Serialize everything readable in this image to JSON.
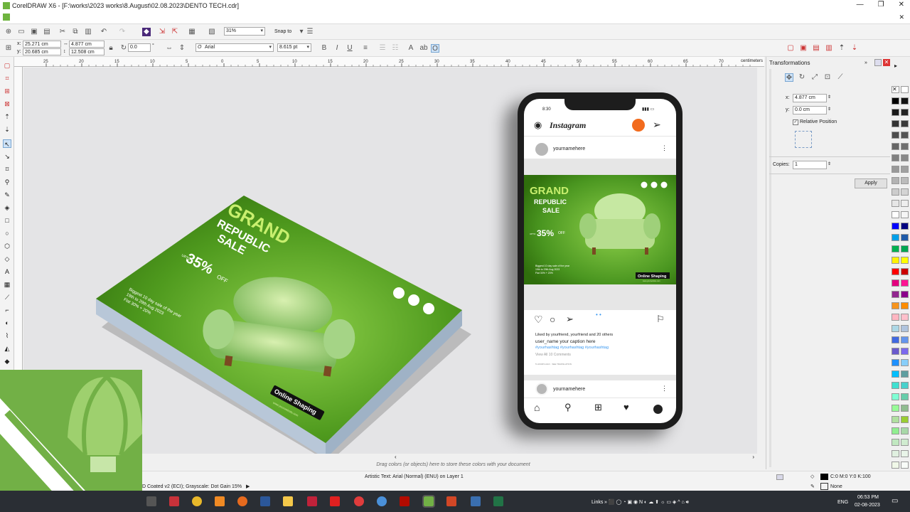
{
  "window": {
    "title": "CorelDRAW X6 - [F:\\works\\2023 works\\8.August\\02.08.2023\\DENTO TECH.cdr]"
  },
  "standard_bar": {
    "zoom": "31%",
    "snap_to": "Snap to"
  },
  "property_bar": {
    "x_pos": "25.271 cm",
    "y_pos": "20.685 cm",
    "width": "4.877 cm",
    "height": "12.508 cm",
    "rotation": "0.0",
    "degree_symbol": "°",
    "font_name": "Arial",
    "font_size": "8.615 pt"
  },
  "ruler": {
    "h_ticks": [
      "25",
      "20",
      "15",
      "10",
      "5",
      "0",
      "5",
      "10",
      "15",
      "20",
      "25",
      "30",
      "35",
      "40",
      "45",
      "50",
      "55",
      "60",
      "65",
      "70"
    ],
    "unit": "centimeters"
  },
  "flyer": {
    "heading1": "GRAND",
    "heading2": "REPUBLIC",
    "heading3": "SALE",
    "upto": "UPTO",
    "discount": "35%",
    "off": "OFF",
    "desc1": "Biggest 10 day sale of the year",
    "desc2": "19th to 29th Aug 2023",
    "desc3": "Flat 30% + 20%",
    "cta": "Online Shaping",
    "website": "www.yourwebsite.com"
  },
  "phone": {
    "time": "8:30",
    "app_title": "Instagram",
    "username_top": "yournamehere",
    "post": {
      "heading1": "GRAND",
      "heading2": "REPUBLIC",
      "heading3": "SALE",
      "upto": "UPTO",
      "discount": "35%",
      "off": "OFF",
      "desc1": "Biggest 10 day sale of the year",
      "desc2": "19th to 29th Aug 2023",
      "desc3": "Flat 30% + 20%",
      "cta": "Online Shaping",
      "website": "www.yourwebsite.com"
    },
    "liked_by": "Liked by yourfriend, yourfriend and 20 others",
    "caption": "user_name  your caption here",
    "hashtags": "#yourhashtag #yourhashtag #yourhashtag",
    "view_comments": "View All 10 Comments",
    "translation": "5 HOURS AGO  ·  SEE TRANSLATION",
    "username_bottom": "yournamehere"
  },
  "docker": {
    "title": "Transformations",
    "x_label": "x:",
    "x_value": "4.877 cm",
    "y_label": "y:",
    "y_value": "0.0 cm",
    "relative_position": "Relative Position",
    "copies_label": "Copies:",
    "copies_value": "1",
    "apply": "Apply"
  },
  "canvas_hint": "Drag colors (or objects) here to store these colors with your document",
  "status": {
    "object_info": "Artistic Text: Arial (Normal) (ENU) on Layer 1",
    "color_profile": "D Coated v2 (ECI); Grayscale: Dot Gain 15%",
    "fill": "C:0 M:0 Y:0 K:100",
    "outline": "None"
  },
  "taskbar": {
    "links": "Links",
    "language": "ENG",
    "time": "06:53 PM",
    "date": "02-08-2023"
  },
  "colors": {
    "brand_green": "#72b046",
    "flyer_green": "#3f8a16"
  }
}
